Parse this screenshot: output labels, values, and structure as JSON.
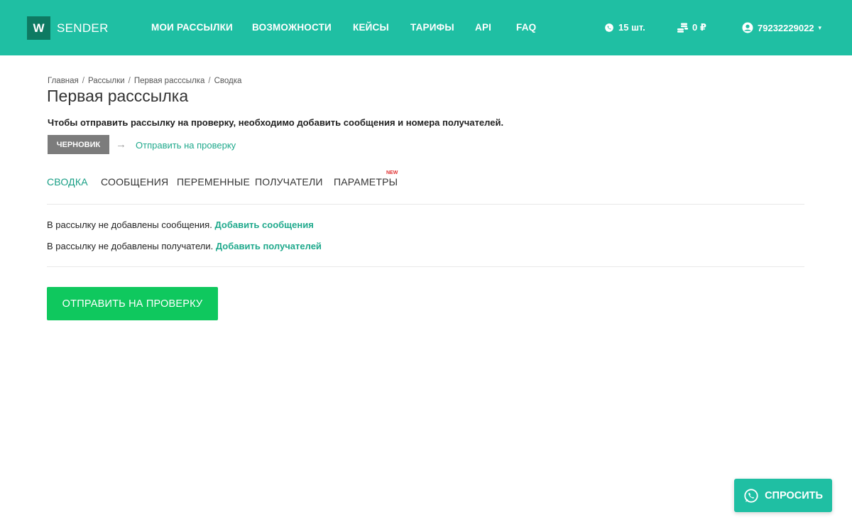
{
  "brand": {
    "logo_letter": "W",
    "name": "SENDER",
    "accent": "#1fbfa3",
    "button_green": "#0fc85e"
  },
  "nav": [
    {
      "label": "МОИ РАССЫЛКИ"
    },
    {
      "label": "ВОЗМОЖНОСТИ"
    },
    {
      "label": "КЕЙСЫ"
    },
    {
      "label": "ТАРИФЫ"
    },
    {
      "label": "API"
    },
    {
      "label": "FAQ"
    }
  ],
  "header_stats": {
    "messages": {
      "icon": "whatsapp-icon",
      "value": "15 шт."
    },
    "balance": {
      "icon": "coins-icon",
      "value": "0 ₽"
    },
    "user": {
      "icon": "user-icon",
      "phone": "79232229022",
      "caret": "▾"
    }
  },
  "breadcrumb": [
    "Главная",
    "Рассылки",
    "Первая расссылка",
    "Сводка"
  ],
  "breadcrumb_separator": "/",
  "page_title": "Первая расссылка",
  "notice": "Чтобы отправить рассылку на проверку, необходимо добавить сообщения и номера получателей.",
  "status": {
    "current": "ЧЕРНОВИК",
    "arrow": "→",
    "next": "Отправить на проверку"
  },
  "tabs": [
    {
      "label": "СВОДКА",
      "active": true
    },
    {
      "label": "СООБЩЕНИЯ",
      "active": false
    },
    {
      "label": "ПЕРЕМЕННЫЕ",
      "active": false
    },
    {
      "label": "ПОЛУЧАТЕЛИ",
      "active": false
    },
    {
      "label": "ПАРАМЕТРЫ",
      "active": false,
      "badge": "NEW"
    }
  ],
  "summary": {
    "messages_text": "В рассылку не добавлены сообщения.",
    "messages_link": "Добавить сообщения",
    "recipients_text": "В рассылку не добавлены получатели.",
    "recipients_link": "Добавить получателей"
  },
  "submit_label": "ОТПРАВИТЬ НА ПРОВЕРКУ",
  "ask_label": "СПРОСИТЬ"
}
